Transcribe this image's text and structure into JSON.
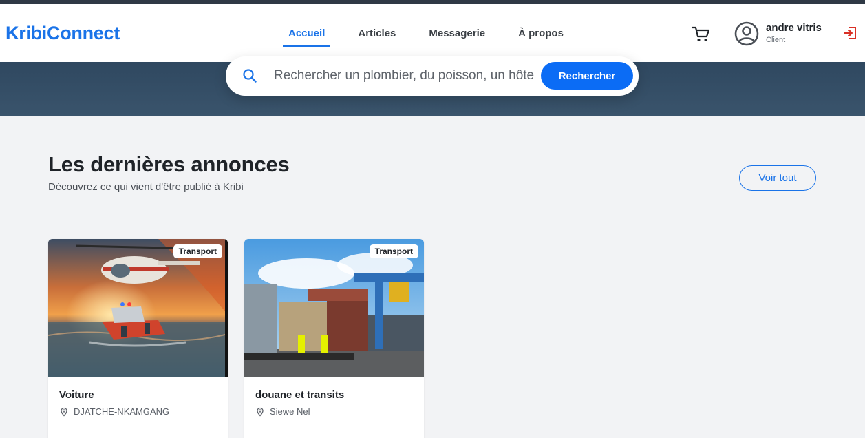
{
  "brand": {
    "name": "KribiConnect",
    "color": "#1a73e8"
  },
  "nav": {
    "items": [
      {
        "label": "Accueil",
        "active": true
      },
      {
        "label": "Articles",
        "active": false
      },
      {
        "label": "Messagerie",
        "active": false
      },
      {
        "label": "À propos",
        "active": false
      }
    ]
  },
  "header_actions": {
    "cart_icon": "cart-icon",
    "avatar_icon": "user-circle-icon",
    "logout_icon": "logout-icon",
    "logout_color": "#d93025"
  },
  "user": {
    "name": "andre vitris",
    "role": "Client"
  },
  "search": {
    "placeholder": "Rechercher un plombier, du poisson, un hôtel...",
    "button_label": "Rechercher",
    "button_color": "#0b6cf5"
  },
  "section": {
    "title": "Les dernières annonces",
    "subtitle": "Découvrez ce qui vient d'être publié à Kribi",
    "see_all_label": "Voir tout"
  },
  "listings": [
    {
      "title": "Voiture",
      "category": "Transport",
      "author": "DJATCHE-NKAMGANG",
      "image": "rescue boat and helicopter at sunset"
    },
    {
      "title": "douane et transits",
      "category": "Transport",
      "author": "Siewe Nel",
      "image": "shipping containers at port with workers"
    }
  ]
}
